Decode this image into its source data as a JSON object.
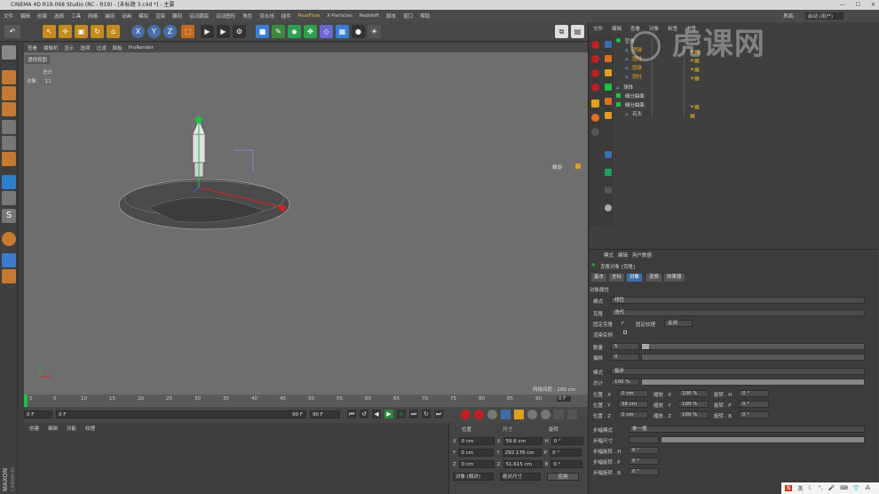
{
  "window": {
    "title": "CINEMA 4D R19.068 Studio (RC - R19) - [未标题 3.c4d *] - 主要",
    "controls": [
      "—",
      "☐",
      "✕"
    ]
  },
  "menubar": {
    "items": [
      "文件",
      "编辑",
      "创建",
      "选择",
      "工具",
      "网格",
      "捕捉",
      "动画",
      "模拟",
      "渲染",
      "雕刻",
      "运动跟踪",
      "运动图形",
      "角色",
      "流水线",
      "插件",
      "RealFlow",
      "X-Particles",
      "Redshift",
      "脚本",
      "窗口",
      "帮助"
    ],
    "highlight": "RealFlow",
    "layout_label": "界面:",
    "layout_value": "启动 (用户)"
  },
  "viewport": {
    "menu": [
      "查看",
      "摄像机",
      "显示",
      "选项",
      "过滤",
      "面板",
      "ProRender"
    ],
    "label": "透视视图",
    "stats_title": "总计",
    "stats_label": "对象",
    "stats_value": "11",
    "grid_label": "网格间距 : 100 cm",
    "side_badge": "螺旋"
  },
  "timeline": {
    "ticks": [
      "0",
      "5",
      "10",
      "15",
      "20",
      "25",
      "30",
      "35",
      "40",
      "45",
      "50",
      "55",
      "60",
      "65",
      "70",
      "75",
      "80",
      "85",
      "90"
    ],
    "current_frame_right": "0 F",
    "start": "0 F",
    "start2": "0 F",
    "end_small": "90 F",
    "end": "90 F"
  },
  "bottom_left_menu": [
    "创建",
    "编辑",
    "功能",
    "纹理"
  ],
  "coords": {
    "headers": [
      "位置",
      "尺寸",
      "旋转"
    ],
    "rows": [
      {
        "axis": "X",
        "pos": "0 cm",
        "size": "59.6 cm",
        "rot_axis": "H",
        "rot": "0 °"
      },
      {
        "axis": "Y",
        "pos": "0 cm",
        "size": "292.176 cm",
        "rot_axis": "P",
        "rot": "0 °"
      },
      {
        "axis": "Z",
        "pos": "0 cm",
        "size": "51.615 cm",
        "rot_axis": "B",
        "rot": "0 °"
      }
    ],
    "mode1": "对象 (相对)",
    "mode2": "绝对尺寸",
    "apply": "应用"
  },
  "object_manager": {
    "tabs": [
      "文件",
      "编辑",
      "查看",
      "对象",
      "标签",
      "书签"
    ],
    "objects": [
      {
        "name": "空白",
        "indent": 0
      },
      {
        "name": "圆锥",
        "indent": 1
      },
      {
        "name": "圆柱",
        "indent": 1
      },
      {
        "name": "圆锥",
        "indent": 1
      },
      {
        "name": "圆柱",
        "indent": 1
      },
      {
        "name": "球体",
        "indent": 0
      },
      {
        "name": "细分曲面",
        "indent": 0
      },
      {
        "name": "细分曲面",
        "indent": 0
      },
      {
        "name": "石头",
        "indent": 1
      }
    ]
  },
  "attributes": {
    "menu": [
      "模式",
      "编辑",
      "用户数据"
    ],
    "object_title": "克隆对象 [克隆]",
    "tabs": [
      "基本",
      "坐标",
      "对象",
      "变换",
      "效果器"
    ],
    "active_tab": "对象",
    "section": "对象属性",
    "mode_label": "模式",
    "mode_value": "线性",
    "clone_label": "克隆",
    "clone_value": "迭代",
    "fixed_clone": "固定克隆",
    "fixed_clone_check": "✓",
    "fixed_texture": "固定纹理",
    "fixed_texture_value": "关闭",
    "render_instances": "渲染实例",
    "count_label": "数量",
    "count_value": "5",
    "offset_label": "偏移",
    "offset_value": "0",
    "mode2_label": "模式",
    "mode2_value": "每步",
    "total_label": "总计",
    "total_value": "100 %",
    "pos_x_label": "位置 . X",
    "pos_x": "0 cm",
    "pos_y_label": "位置 . Y",
    "pos_y": "58 cm",
    "pos_z_label": "位置 . Z",
    "pos_z": "0 cm",
    "scale_x_label": "缩放 . X",
    "scale_x": "100 %",
    "scale_y_label": "缩放 . Y",
    "scale_y": "100 %",
    "scale_z_label": "缩放 . Z",
    "scale_z": "100 %",
    "rot_h_label": "旋转 . H",
    "rot_h": "0 °",
    "rot_p_label": "旋转 . P",
    "rot_p": "0 °",
    "rot_b_label": "旋转 . B",
    "rot_b": "0 °",
    "step_mode_label": "步幅模式",
    "step_mode_value": "单一值",
    "step_size_label": "步幅尺寸",
    "step_size_value": "100 %",
    "step_rot_h_label": "步幅旋转 . H",
    "step_rot_h": "0 °",
    "step_rot_p_label": "步幅旋转 . P",
    "step_rot_p": "0 °",
    "step_rot_b_label": "步幅旋转 . B",
    "step_rot_b": "0 °"
  },
  "watermark": "虎课网",
  "taskbar": {
    "ime": "英"
  },
  "colors": {
    "viewport_bg": "#6e6e6e",
    "active_tab": "#3b6ea8",
    "accent_orange": "#e0a020",
    "axis_green": "#20c040",
    "axis_red": "#e02020"
  }
}
